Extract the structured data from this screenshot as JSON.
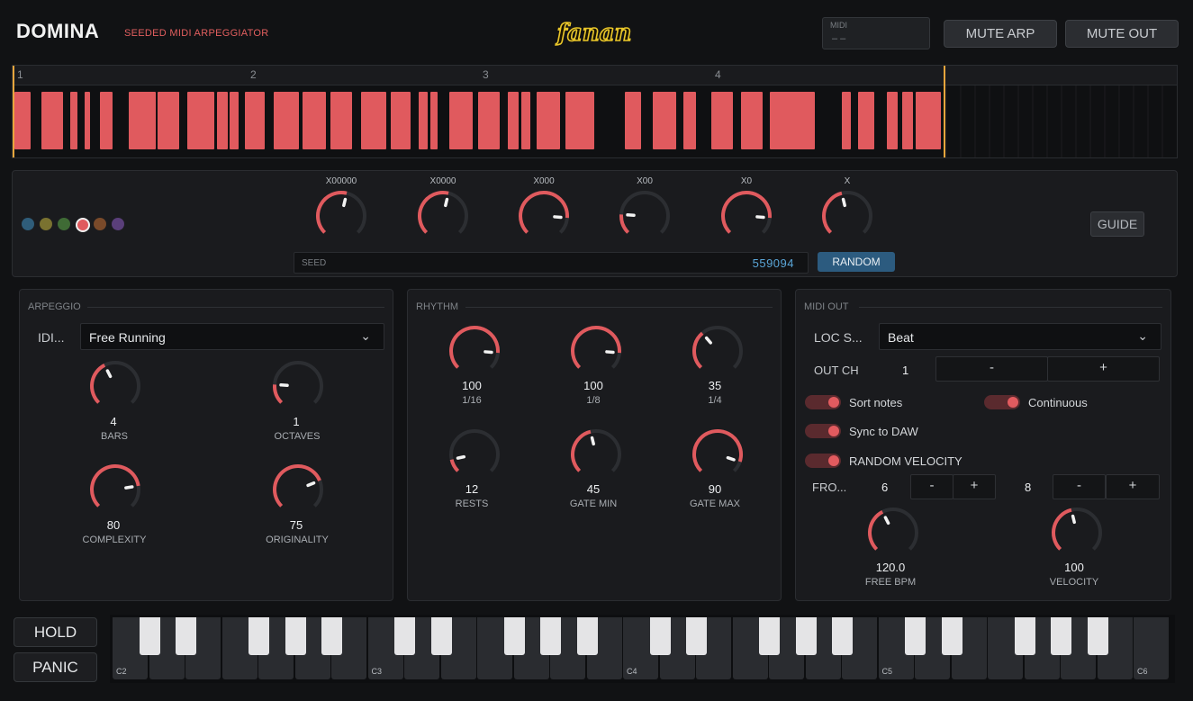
{
  "header": {
    "title": "DOMINA",
    "subtitle": "SEEDED MIDI ARPEGGIATOR",
    "logo_text": "fanan",
    "midi_label": "MIDI",
    "midi_value": "– –",
    "mute_arp": "MUTE ARP",
    "mute_out": "MUTE OUT"
  },
  "timeline": {
    "bars": [
      "1",
      "2",
      "3",
      "4"
    ],
    "accent_color": "#e05a5e"
  },
  "colors": {
    "accent": "#e05a5e",
    "seed_text": "#5aa6d8",
    "swatches": [
      "#2f5d7a",
      "#7a7230",
      "#3f6b35",
      "#e05a5e",
      "#7a4a2a",
      "#5a3f7a"
    ]
  },
  "seed_knobs": [
    {
      "label": "X00000",
      "level": 0.55
    },
    {
      "label": "X0000",
      "level": 0.55
    },
    {
      "label": "X000",
      "level": 0.85
    },
    {
      "label": "X00",
      "level": 0.18
    },
    {
      "label": "X0",
      "level": 0.85
    },
    {
      "label": "X",
      "level": 0.45
    }
  ],
  "seed": {
    "label": "SEED",
    "value": "559094",
    "random": "RANDOM"
  },
  "guide": "GUIDE",
  "arpeggio": {
    "title": "ARPEGGIO",
    "idiom_label": "IDI...",
    "idiom_value": "Free Running",
    "knobs": [
      {
        "value": "4",
        "label": "BARS",
        "level": 0.4
      },
      {
        "value": "1",
        "label": "OCTAVES",
        "level": 0.18
      },
      {
        "value": "80",
        "label": "COMPLEXITY",
        "level": 0.8
      },
      {
        "value": "75",
        "label": "ORIGINALITY",
        "level": 0.75
      }
    ]
  },
  "rhythm": {
    "title": "RHYTHM",
    "knobs": [
      {
        "value": "100",
        "label": "1/16",
        "level": 0.85
      },
      {
        "value": "100",
        "label": "1/8",
        "level": 0.85
      },
      {
        "value": "35",
        "label": "1/4",
        "level": 0.35
      },
      {
        "value": "12",
        "label": "RESTS",
        "level": 0.12
      },
      {
        "value": "45",
        "label": "GATE MIN",
        "level": 0.45
      },
      {
        "value": "90",
        "label": "GATE MAX",
        "level": 0.9
      }
    ]
  },
  "midi_out": {
    "title": "MIDI OUT",
    "loc_label": "LOC S...",
    "loc_value": "Beat",
    "out_ch_label": "OUT CH",
    "out_ch_value": "1",
    "minus": "-",
    "plus": "+",
    "sort_notes": "Sort notes",
    "continuous": "Continuous",
    "sync_daw": "Sync to DAW",
    "random_velocity": "RANDOM VELOCITY",
    "from_label": "FRO...",
    "from_value": "6",
    "to_value": "8",
    "knobs": [
      {
        "value": "120.0",
        "label": "FREE BPM",
        "level": 0.4
      },
      {
        "value": "100",
        "label": "VELOCITY",
        "level": 0.45
      }
    ]
  },
  "buttons": {
    "hold": "HOLD",
    "panic": "PANIC"
  },
  "keyboard": {
    "octave_labels": [
      "C2",
      "C3",
      "C4",
      "C5",
      "C6"
    ]
  }
}
